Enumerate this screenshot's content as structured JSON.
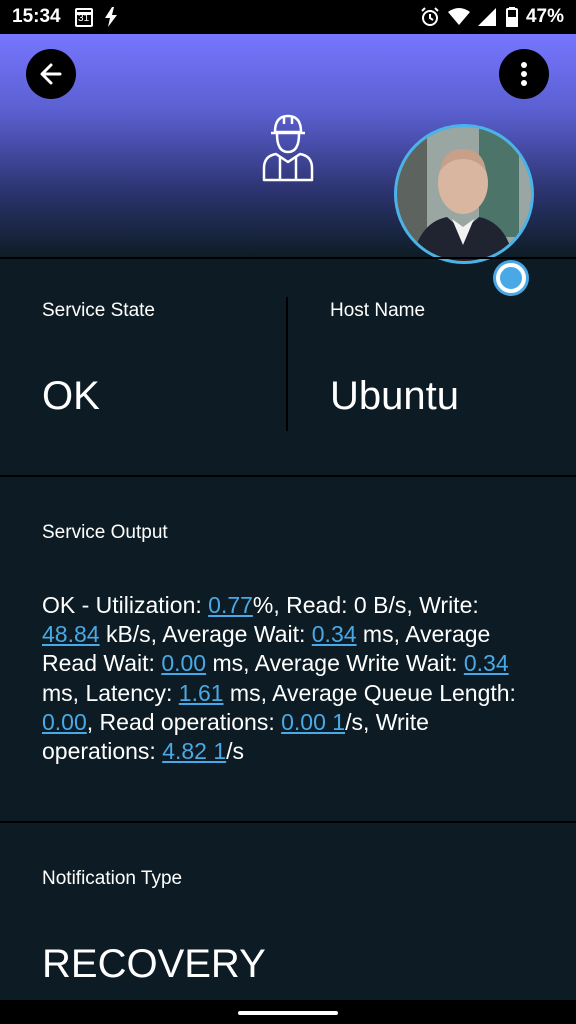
{
  "status_bar": {
    "time": "15:34",
    "calendar_day": "31",
    "battery": "47%"
  },
  "header": {
    "back_icon": "arrow-left-icon",
    "menu_icon": "more-vertical-icon",
    "service_icon": "worker-icon",
    "accent_color": "#49a9e6"
  },
  "service_state": {
    "label": "Service State",
    "value": "OK"
  },
  "host_name": {
    "label": "Host Name",
    "value": "Ubuntu"
  },
  "service_output": {
    "label": "Service Output",
    "segments": [
      {
        "text": "OK - Utilization: ",
        "link": false
      },
      {
        "text": "0.77",
        "link": true
      },
      {
        "text": "%, Read: 0 B/s, Write: ",
        "link": false
      },
      {
        "text": "48.84",
        "link": true
      },
      {
        "text": " kB/s, Average Wait: ",
        "link": false
      },
      {
        "text": "0.34",
        "link": true
      },
      {
        "text": " ms, Average Read Wait: ",
        "link": false
      },
      {
        "text": "0.00",
        "link": true
      },
      {
        "text": " ms, Average Write Wait: ",
        "link": false
      },
      {
        "text": "0.34",
        "link": true
      },
      {
        "text": " ms, Latency: ",
        "link": false
      },
      {
        "text": "1.61",
        "link": true
      },
      {
        "text": " ms, Average Queue Length: ",
        "link": false
      },
      {
        "text": "0.00",
        "link": true
      },
      {
        "text": ", Read operations: ",
        "link": false
      },
      {
        "text": "0.00 1",
        "link": true
      },
      {
        "text": "/s, Write operations: ",
        "link": false
      },
      {
        "text": "4.82 1",
        "link": true
      },
      {
        "text": "/s",
        "link": false
      }
    ]
  },
  "notification_type": {
    "label": "Notification Type",
    "value": "RECOVERY"
  }
}
